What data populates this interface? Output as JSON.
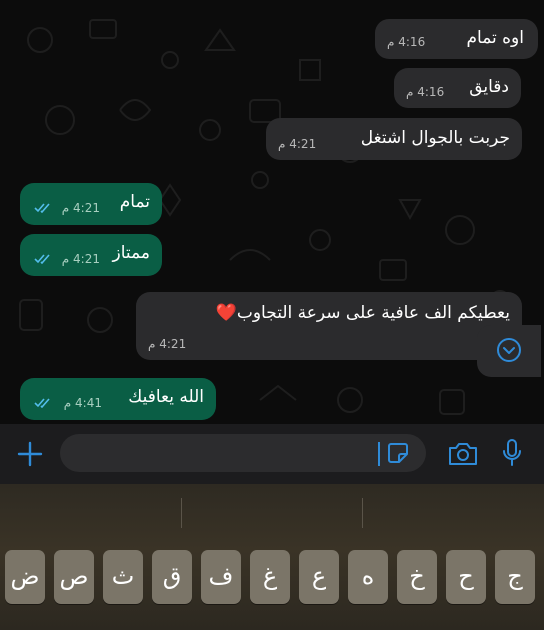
{
  "messages": [
    {
      "id": "m1",
      "dir": "in",
      "text": "اوه تمام",
      "time": "4:16 م"
    },
    {
      "id": "m2",
      "dir": "in",
      "text": "دقايق",
      "time": "4:16 م"
    },
    {
      "id": "m3",
      "dir": "in",
      "text": "جربت بالجوال اشتغل",
      "time": "4:21 م"
    },
    {
      "id": "m4",
      "dir": "out",
      "text": "تمام",
      "time": "4:21 م"
    },
    {
      "id": "m5",
      "dir": "out",
      "text": "ممتاز",
      "time": "4:21 م"
    },
    {
      "id": "m6",
      "dir": "in",
      "text": "يعطيكم الف عافية على سرعة التجاوب",
      "time": "4:21 م",
      "emoji": "❤️"
    },
    {
      "id": "m7",
      "dir": "out",
      "text": "الله يعافيك",
      "time": "4:41 م"
    }
  ],
  "colors": {
    "incoming": "#2b2b2d",
    "outgoing": "#0a5e45",
    "accent": "#2f8bd8",
    "read_ticks": "#53bdeb"
  },
  "icons": {
    "add": "plus-icon",
    "sticker": "sticker-icon",
    "camera": "camera-icon",
    "mic": "microphone-icon",
    "scroll": "chevron-down-icon",
    "read": "double-check-icon"
  },
  "keyboard": {
    "row1": [
      "ض",
      "ص",
      "ث",
      "ق",
      "ف",
      "غ",
      "ع",
      "ه",
      "خ",
      "ح",
      "ج"
    ]
  }
}
